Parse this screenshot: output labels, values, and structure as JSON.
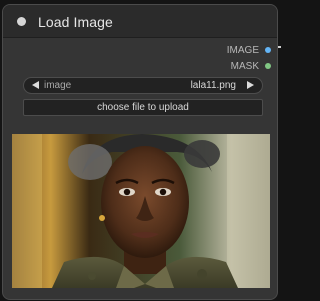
{
  "node": {
    "title": "Load Image"
  },
  "outputs": [
    {
      "label": "IMAGE",
      "color": "#64b5f6"
    },
    {
      "label": "MASK",
      "color": "#81c784"
    }
  ],
  "widgets": {
    "image_combo": {
      "label": "image",
      "value": "lala11.png"
    },
    "upload_button": {
      "label": "choose file to upload"
    }
  },
  "preview": {
    "description_icon": "portrait-image"
  },
  "colors": {
    "node_bg": "#353535",
    "title_bg": "#2b2b2b",
    "canvas_bg": "#141414",
    "image_port": "#64b5f6",
    "mask_port": "#81c784"
  }
}
